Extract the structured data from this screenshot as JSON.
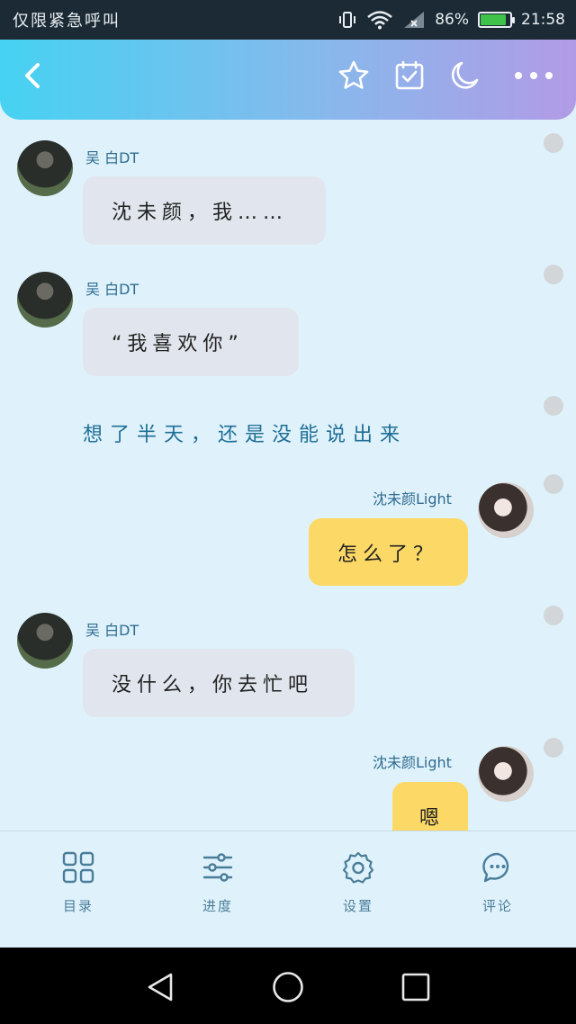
{
  "status_bar": {
    "left_text": "仅限紧急呼叫",
    "battery": "86%",
    "time": "21:58",
    "battery_level": 0.86
  },
  "header": {
    "icons": [
      "back-icon",
      "star-icon",
      "calendar-check-icon",
      "moon-icon",
      "more-icon"
    ]
  },
  "messages": [
    {
      "type": "left",
      "name": "吴 白DT",
      "text": "沈未颜，我……"
    },
    {
      "type": "left",
      "name": "吴 白DT",
      "text": "“我喜欢你”"
    },
    {
      "type": "narration",
      "text": "想了半天，还是没能说出来"
    },
    {
      "type": "right",
      "name": "沈未颜Light",
      "text": "怎么了？"
    },
    {
      "type": "left",
      "name": "吴 白DT",
      "text": "没什么，你去忙吧"
    },
    {
      "type": "right",
      "name": "沈未颜Light",
      "text": "嗯"
    }
  ],
  "toolbar": {
    "catalog": "目录",
    "progress": "进度",
    "settings": "设置",
    "comments": "评论"
  },
  "colors": {
    "header_start": "#46d2f2",
    "header_end": "#b29be6",
    "bubble_left": "#e1e6ee",
    "bubble_right": "#fcd966",
    "name_color": "#2e6b8f",
    "narration_color": "#1f6e96"
  }
}
